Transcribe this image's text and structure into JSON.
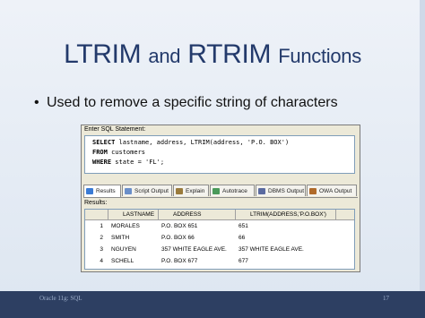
{
  "slide": {
    "title_part1": "LTRIM",
    "title_part2": "and",
    "title_part3": "RTRIM",
    "title_part4": "Functions",
    "bullet": "Used to remove a specific string of characters"
  },
  "sql_panel": {
    "label": "Enter SQL Statement:",
    "lines": [
      {
        "kw": "SELECT",
        "rest": " lastname, address, LTRIM(address, 'P.O. BOX')"
      },
      {
        "kw": "FROM",
        "rest": " customers"
      },
      {
        "kw": "WHERE",
        "rest": " state = 'FL';"
      }
    ]
  },
  "tabs": [
    {
      "label": "Results",
      "active": true,
      "icon": "results-icon",
      "color": "#3a7bd5"
    },
    {
      "label": "Script Output",
      "active": false,
      "icon": "script-icon",
      "color": "#6a8fc9"
    },
    {
      "label": "Explain",
      "active": false,
      "icon": "explain-icon",
      "color": "#9a7b3c"
    },
    {
      "label": "Autotrace",
      "active": false,
      "icon": "autotrace-icon",
      "color": "#4a9a5a"
    },
    {
      "label": "DBMS Output",
      "active": false,
      "icon": "dbms-icon",
      "color": "#5a6aa0"
    },
    {
      "label": "OWA Output",
      "active": false,
      "icon": "owa-icon",
      "color": "#b06a2a"
    }
  ],
  "results": {
    "label": "Results:",
    "columns": [
      "LASTNAME",
      "ADDRESS",
      "LTRIM(ADDRESS,'P.O.BOX')"
    ],
    "rows": [
      {
        "n": "1",
        "lastname": "MORALES",
        "address": "P.O. BOX 651",
        "trimmed": "651"
      },
      {
        "n": "2",
        "lastname": "SMITH",
        "address": "P.O. BOX 66",
        "trimmed": "66"
      },
      {
        "n": "3",
        "lastname": "NGUYEN",
        "address": "357 WHITE EAGLE AVE.",
        "trimmed": "357 WHITE EAGLE AVE."
      },
      {
        "n": "4",
        "lastname": "SCHELL",
        "address": "P.O. BOX 677",
        "trimmed": "677"
      }
    ]
  },
  "footer": {
    "left": "Oracle 11g: SQL",
    "right": "17"
  }
}
